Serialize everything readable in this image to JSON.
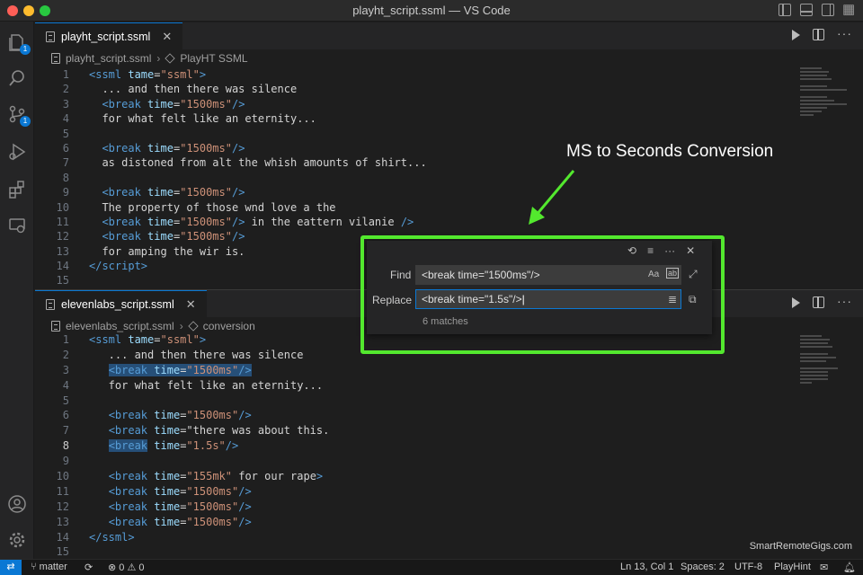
{
  "window": {
    "title": "playht_script.ssml — VS Code"
  },
  "activity_bar": {
    "explorer_badge": "1",
    "scm_badge": "1"
  },
  "editor_top": {
    "tab_label": "playht_script.ssml",
    "breadcrumb": [
      "playht_script.ssml",
      "PlayHT SSML"
    ],
    "lines": [
      {
        "n": "1",
        "html": "<span class=\"tag\">&lt;ssml</span> <span class=\"attr\">tame</span>=<span class=\"str\">\"ssml\"</span><span class=\"tag\">&gt;</span>"
      },
      {
        "n": "2",
        "html": "  ... and then there was silence"
      },
      {
        "n": "3",
        "html": "  <span class=\"tag\">&lt;break</span> <span class=\"attr\">time</span>=<span class=\"str\">\"1500ms\"</span><span class=\"tag\">/&gt;</span>"
      },
      {
        "n": "4",
        "html": "  for what felt like an eternity..."
      },
      {
        "n": "5",
        "html": ""
      },
      {
        "n": "6",
        "html": "  <span class=\"tag\">&lt;break</span> <span class=\"attr\">time</span>=<span class=\"str\">\"1500ms\"</span><span class=\"tag\">/&gt;</span>"
      },
      {
        "n": "7",
        "html": "  as distoned from alt the whish amounts of shirt..."
      },
      {
        "n": "8",
        "html": ""
      },
      {
        "n": "9",
        "html": "  <span class=\"tag\">&lt;break</span> <span class=\"attr\">time</span>=<span class=\"str\">\"1500ms\"</span><span class=\"tag\">/&gt;</span>"
      },
      {
        "n": "10",
        "html": "  The property of those wnd love a the"
      },
      {
        "n": "11",
        "html": "  <span class=\"tag\">&lt;break</span> <span class=\"attr\">time</span>=<span class=\"str\">\"1500ms\"</span><span class=\"tag\">/&gt;</span> in the eattern vilanie <span class=\"tag\">/&gt;</span>"
      },
      {
        "n": "12",
        "html": "  <span class=\"tag\">&lt;break</span> <span class=\"attr\">time</span>=<span class=\"str\">\"1500ms\"</span><span class=\"tag\">/&gt;</span>"
      },
      {
        "n": "13",
        "html": "  for amping the wir is."
      },
      {
        "n": "14",
        "html": "<span class=\"tag\">&lt;/script&gt;</span>"
      },
      {
        "n": "15",
        "html": ""
      }
    ]
  },
  "editor_bottom": {
    "tab_label": "elevenlabs_script.ssml",
    "breadcrumb": [
      "elevenlabs_script.ssml",
      "conversion"
    ],
    "current_line": "8",
    "lines": [
      {
        "n": "1",
        "html": "<span class=\"tag\">&lt;ssml</span> <span class=\"attr\">tame</span>=<span class=\"str\">\"ssml\"</span><span class=\"tag\">&gt;</span>"
      },
      {
        "n": "2",
        "html": "   ... and then there was silence"
      },
      {
        "n": "3",
        "html": "   <span class=\"hl\"><span class=\"tag\">&lt;break</span> <span class=\"attr\">time</span>=<span class=\"str\">\"1500ms\"</span><span class=\"tag\">/&gt;</span></span>"
      },
      {
        "n": "4",
        "html": "   for what felt like an eternity..."
      },
      {
        "n": "5",
        "html": ""
      },
      {
        "n": "6",
        "html": "   <span class=\"tag\">&lt;break</span> <span class=\"attr\">time</span>=<span class=\"str\">\"1500ms\"</span><span class=\"tag\">/&gt;</span>"
      },
      {
        "n": "7",
        "html": "   <span class=\"tag\">&lt;break</span> <span class=\"attr\">time</span>=\"there was about this."
      },
      {
        "n": "8",
        "html": "   <span class=\"hl\"><span class=\"tag\">&lt;break</span></span> <span class=\"attr\">time</span>=<span class=\"str\">\"1.5s\"</span><span class=\"tag\">/&gt;</span>"
      },
      {
        "n": "9",
        "html": ""
      },
      {
        "n": "10",
        "html": "   <span class=\"tag\">&lt;break</span> <span class=\"attr\">time</span>=<span class=\"str\">\"155mk\"</span> for our rape<span class=\"tag\">&gt;</span>"
      },
      {
        "n": "11",
        "html": "   <span class=\"tag\">&lt;break</span> <span class=\"attr\">time</span>=<span class=\"str\">\"1500ms\"</span><span class=\"tag\">/&gt;</span>"
      },
      {
        "n": "12",
        "html": "   <span class=\"tag\">&lt;break</span> <span class=\"attr\">time</span>=<span class=\"str\">\"1500ms\"</span><span class=\"tag\">/&gt;</span>"
      },
      {
        "n": "13",
        "html": "   <span class=\"tag\">&lt;break</span> <span class=\"attr\">time</span>=<span class=\"str\">\"1500ms\"</span><span class=\"tag\">/&gt;</span>"
      },
      {
        "n": "14",
        "html": "<span class=\"tag\">&lt;/ssml&gt;</span>"
      },
      {
        "n": "15",
        "html": ""
      }
    ]
  },
  "find_widget": {
    "find_label": "Find",
    "replace_label": "Replace",
    "find_value": "<break time=\"1500ms\"/>",
    "replace_value": "<break time=\"1.5s\"/>",
    "match_case_label": "Aa",
    "matches": "6 matches"
  },
  "annotation": {
    "text": "MS to Seconds Conversion",
    "color": "#53e82e"
  },
  "status_bar": {
    "branch": "matter",
    "problems": "0 ⚠ 0",
    "position": "Ln 13, Col 1",
    "spaces": "Spaces: 2",
    "encoding": "UTF-8",
    "language": "PlayHint"
  },
  "watermark": "SmartRemoteGigs.com",
  "colors": {
    "accent": "#0a78d4",
    "highlight_border": "#53e82e"
  }
}
